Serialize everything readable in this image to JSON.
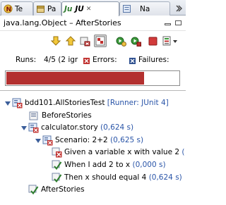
{
  "tabs": [
    {
      "label": "Te"
    },
    {
      "label": "Pa"
    },
    {
      "label": "JU",
      "prefix": "Ju",
      "close": "✕"
    },
    {
      "label": "Na"
    }
  ],
  "view": {
    "title": "java.lang.Object – AfterStories"
  },
  "toolbar": {
    "icons": [
      "next-failure-icon",
      "previous-failure-icon",
      "relaunch-failed-tests-icon",
      "show-failures-only-icon",
      "rerun-test-icon",
      "rerun-failed-first-icon",
      "stop-icon",
      "history-icon",
      "view-menu-icon"
    ]
  },
  "counters": {
    "runs_label": "Runs:",
    "runs_value": "4/5 (2 igr",
    "errors_label": "Errors:",
    "failures_label": "Failures:"
  },
  "progress": {
    "fraction": 0.8,
    "color": "#b3302f"
  },
  "tree": {
    "root": {
      "name": "bdd101.AllStoriesTest",
      "meta": " [Runner: JUnit 4]"
    },
    "before": "BeforeStories",
    "story": {
      "name": "calculator.story",
      "time": " (0,624 s)"
    },
    "scenario": {
      "name": "Scenario: 2+2",
      "time": " (0,625 s)"
    },
    "step1": {
      "name": "Given a variable x with value 2",
      "time": " ("
    },
    "step2": {
      "name": "When I add 2 to x",
      "time": " (0,000 s)"
    },
    "step3": {
      "name": "Then x should equal 4",
      "time": " (0,624 s)"
    },
    "after": "AfterStories"
  }
}
